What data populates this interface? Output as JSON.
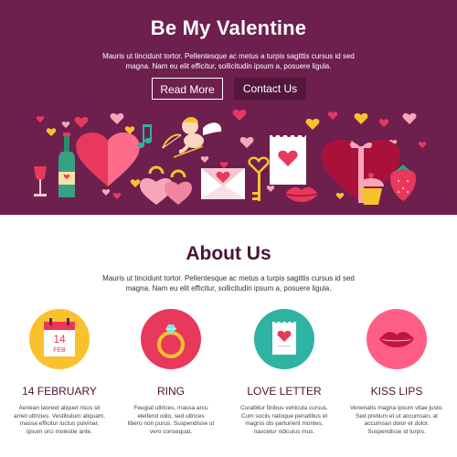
{
  "colors": {
    "hero_bg": "#6d1f4e",
    "heading": "#4a1433",
    "accent_pink": "#e8385c",
    "accent_yellow": "#f9c22d",
    "accent_teal": "#2fb3a3"
  },
  "hero": {
    "title": "Be My Valentine",
    "desc_line1": "Mauris ut tincidunt tortor. Pellentesque ac metus a turpis sagittis cursus id sed",
    "desc_line2": "magna. Nam eu elit efficitur, sollicitudin ipsum a, posuere ligula.",
    "read_more": "Read More",
    "contact_us": "Contact Us",
    "illustration_icons": [
      "wine-glass-icon",
      "wine-bottle-icon",
      "heart-icon",
      "padlock-icon",
      "cupid-icon",
      "music-note-icon",
      "key-icon",
      "envelope-icon",
      "love-letter-icon",
      "lips-icon",
      "gift-box-icon",
      "cupcake-icon",
      "strawberry-icon"
    ]
  },
  "about": {
    "title": "About Us",
    "desc_line1": "Mauris ut tincidunt tortor. Pellentesque ac metus a turpis sagittis cursus id sed",
    "desc_line2": "magna. Nam eu elit efficitur, sollicitudin ipsum a, posuere ligula."
  },
  "features": [
    {
      "icon": "calendar-icon",
      "title": "14 FEBRUARY",
      "calendar_day": "14",
      "calendar_month": "FEB",
      "lines": [
        "Aenean laoreet aliquet risus sit",
        "amet ultricies. Vestibulum aliquam,",
        "massa efficitur luctus pulvinar,",
        "ipsum orci molestie ante."
      ]
    },
    {
      "icon": "ring-icon",
      "title": "RING",
      "lines": [
        "Feugiat ultrices, massa arcu",
        "eleifend odio, sed ultrices",
        "libero non purus. Suspendisse ut",
        "vero consequat."
      ]
    },
    {
      "icon": "love-letter-icon",
      "title": "LOVE LETTER",
      "lines": [
        "Curabitur finibus vehicula cursus.",
        "Cum sociis natoque penatibus et",
        "magnis dis parturient montes,",
        "nascetur ridiculus mus."
      ]
    },
    {
      "icon": "lips-icon",
      "title": "KISS LIPS",
      "lines": [
        "Venenatis magna ipsum vitae justo.",
        "Sed pretium et ut accumsan, at",
        "accumsan dolor et dolor.",
        "Suspendisse id turpis."
      ]
    }
  ]
}
